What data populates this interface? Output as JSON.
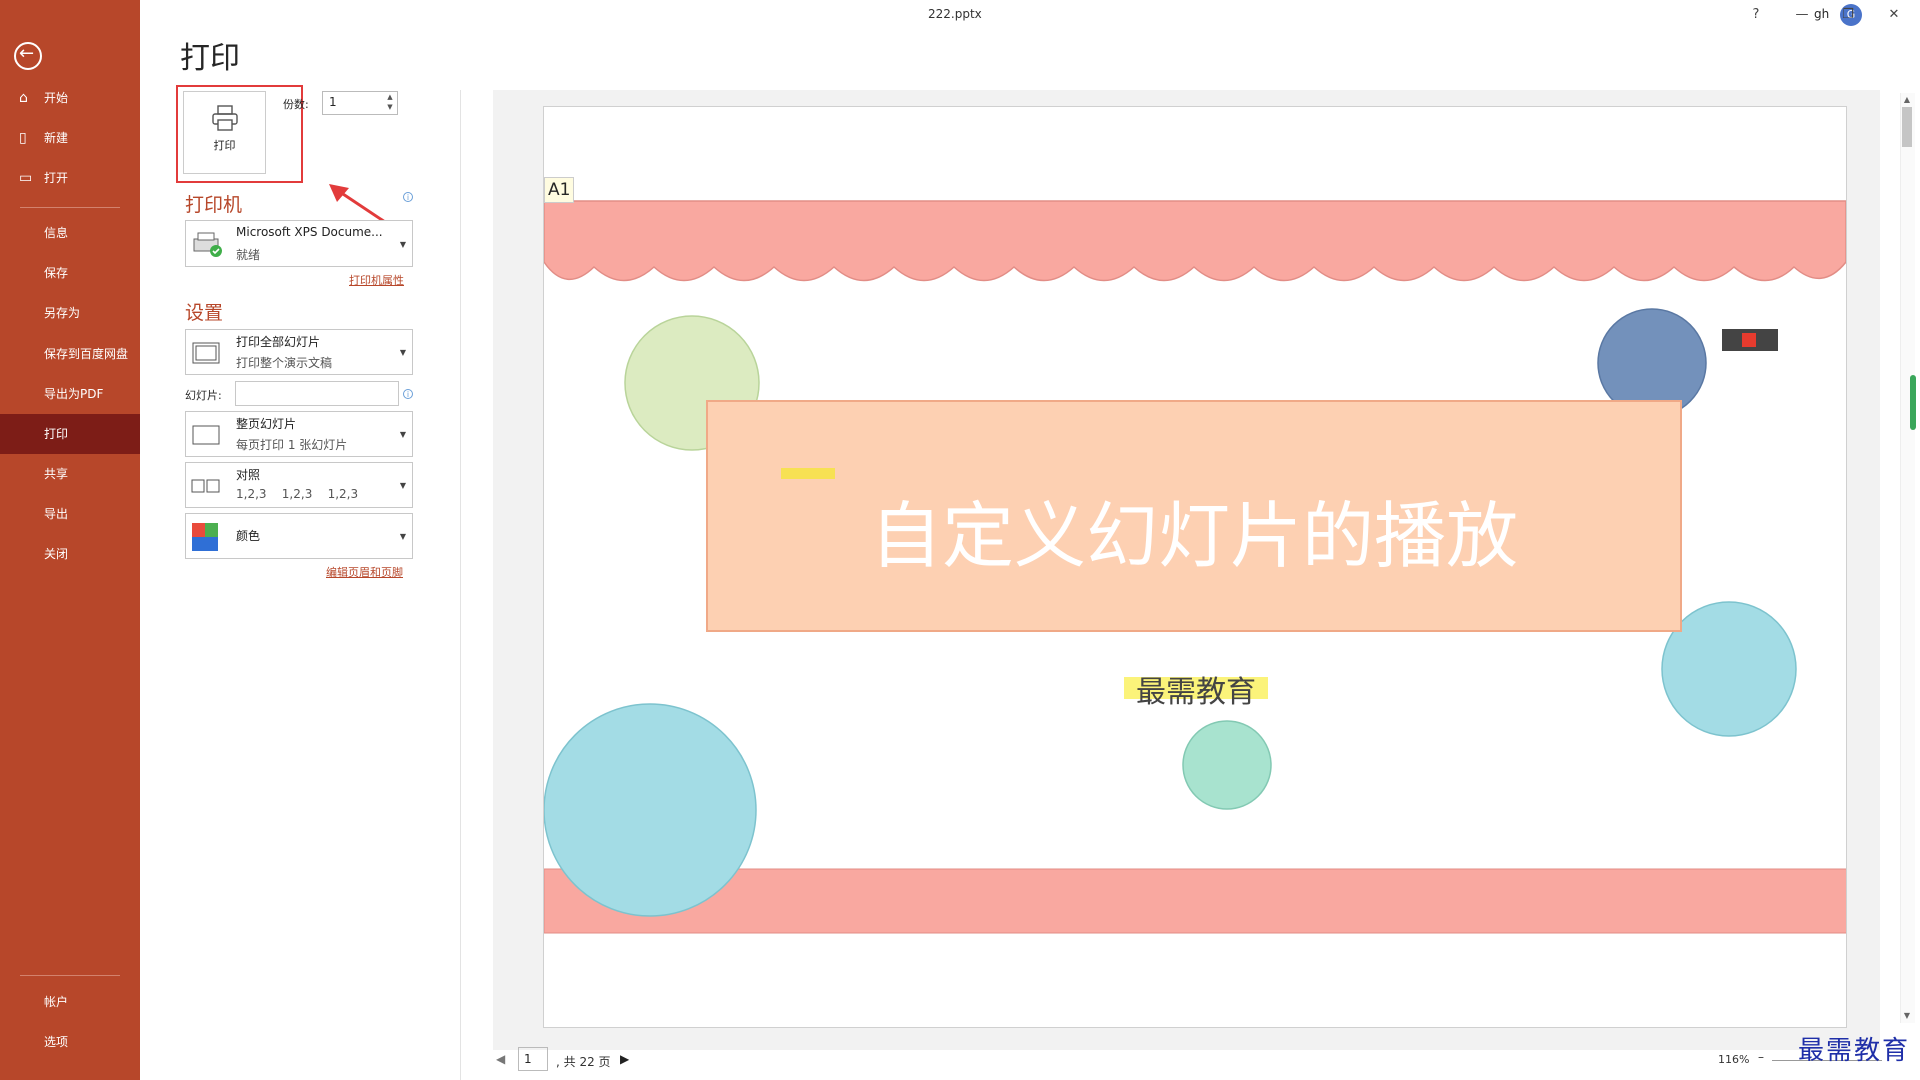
{
  "window": {
    "doc_title": "222.pptx",
    "user": "gh",
    "avatar_initial": "G",
    "help": "?",
    "minimize": "—",
    "restore": "❐",
    "close": "✕"
  },
  "sidebar": {
    "accent_color": "#b7472a",
    "items": [
      {
        "label": "开始",
        "icon": "home-icon"
      },
      {
        "label": "新建",
        "icon": "new-doc-icon"
      },
      {
        "label": "打开",
        "icon": "folder-icon"
      },
      {
        "label": "信息"
      },
      {
        "label": "保存"
      },
      {
        "label": "另存为"
      },
      {
        "label": "保存到百度网盘"
      },
      {
        "label": "导出为PDF"
      },
      {
        "label": "打印",
        "active": true
      },
      {
        "label": "共享"
      },
      {
        "label": "导出"
      },
      {
        "label": "关闭"
      }
    ],
    "bottom_items": [
      {
        "label": "帐户"
      },
      {
        "label": "选项"
      }
    ]
  },
  "print": {
    "page_title": "打印",
    "print_button_label": "打印",
    "copies_label": "份数:",
    "copies_value": "1",
    "printer_section": "打印机",
    "printer_name": "Microsoft XPS Docume...",
    "printer_status": "就绪",
    "printer_properties_link": "打印机属性",
    "settings_section": "设置",
    "range_main": "打印全部幻灯片",
    "range_sub": "打印整个演示文稿",
    "slides_label": "幻灯片:",
    "slides_value": "",
    "layout_main": "整页幻灯片",
    "layout_sub": "每页打印 1 张幻灯片",
    "collate_main": "对照",
    "collate_sub": "1,2,3    1,2,3    1,2,3",
    "color_main": "颜色",
    "header_footer_link": "编辑页眉和页脚"
  },
  "preview": {
    "slide_tag": "A1",
    "slide_title": "自定义幻灯片的播放",
    "slide_subtitle": "最需教育",
    "page_current": "1",
    "page_total": ", 共 22 页",
    "zoom": "116%",
    "watermark": "最需教育"
  }
}
